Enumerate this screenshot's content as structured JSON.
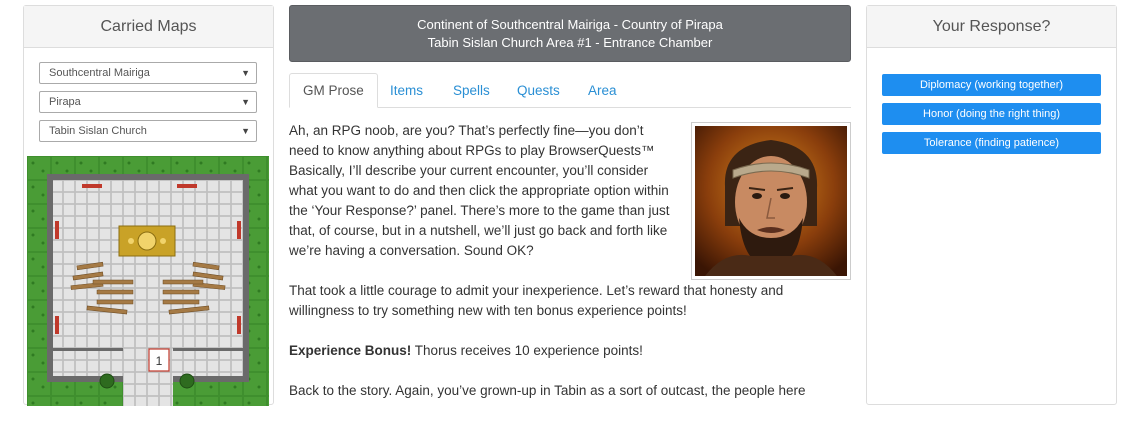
{
  "left_panel": {
    "title": "Carried Maps",
    "selects": [
      {
        "value": "Southcentral Mairiga"
      },
      {
        "value": "Pirapa"
      },
      {
        "value": "Tabin Sislan Church"
      }
    ],
    "map_marker": "1"
  },
  "header": {
    "line1": "Continent of Southcentral Mairiga - Country of Pirapa",
    "line2": "Tabin Sislan Church Area #1 - Entrance Chamber"
  },
  "tabs": [
    {
      "label": "GM Prose",
      "active": true
    },
    {
      "label": "Items"
    },
    {
      "label": "Spells"
    },
    {
      "label": "Quests"
    },
    {
      "label": "Area"
    }
  ],
  "prose": {
    "p1": "Ah, an RPG noob, are you? That’s perfectly fine—you don’t need to know anything about RPGs to play BrowserQuests™ Basically, I’ll describe your current encounter, you’ll consider what you want to do and then click the appropriate option within the ‘Your Response?’ panel. There’s more to the game than just that, of course, but in a nutshell, we’ll just go back and forth like we’re having a conversation. Sound OK?",
    "p2": "That took a little courage to admit your inexperience. Let’s reward that honesty and willingness to try something new with ten bonus experience points!",
    "p3_bold": "Experience Bonus!",
    "p3_rest": " Thorus receives 10 experience points!",
    "p4": "Back to the story. Again, you’ve grown-up in Tabin as a sort of outcast, the people here"
  },
  "right_panel": {
    "title": "Your Response?",
    "buttons": [
      {
        "label": "Diplomacy (working together)"
      },
      {
        "label": "Honor (doing the right thing)"
      },
      {
        "label": "Tolerance (finding patience)"
      }
    ]
  },
  "colors": {
    "button_blue": "#1e8ef0",
    "header_gray": "#6b6e72",
    "link_blue": "#2a8fd4",
    "grass_green": "#3f8f2e"
  }
}
